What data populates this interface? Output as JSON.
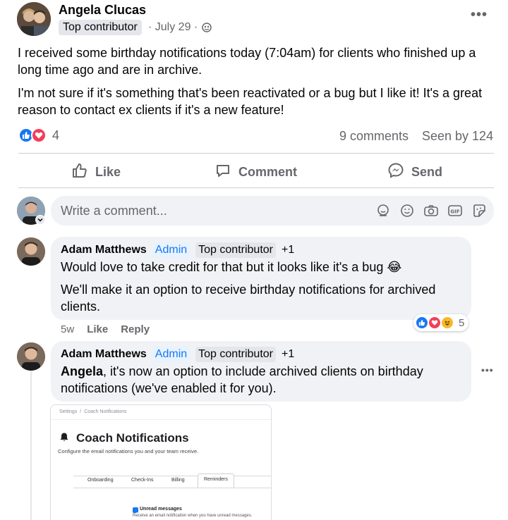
{
  "post": {
    "author": "Angela Clucas",
    "badge": "Top contributor",
    "date": "· July 29 ·",
    "paragraph1": "I received some birthday notifications today (7:04am)  for clients who finished up a long time ago and are in archive.",
    "paragraph2": "I'm not sure if it's something that's been reactivated or a bug but I like it! It's a great reason to contact ex clients if it's a new feature!",
    "reaction_count": "4",
    "comments": "9 comments",
    "seen": "Seen by 124"
  },
  "actions": {
    "like": "Like",
    "comment": "Comment",
    "send": "Send"
  },
  "composer": {
    "placeholder": "Write a comment..."
  },
  "comments": [
    {
      "author": "Adam Matthews",
      "admin": "Admin",
      "badge": "Top contributor",
      "plus": "+1",
      "line1": "Would love to take credit for that but it looks like it's a bug 😂",
      "line2": "We'll make it an option to receive birthday notifications for archived clients.",
      "time": "5w",
      "like": "Like",
      "reply": "Reply",
      "reaction_count": "5"
    },
    {
      "author": "Adam Matthews",
      "admin": "Admin",
      "badge": "Top contributor",
      "plus": "+1",
      "mention": "Angela",
      "text": ", it's now an option to include archived clients on birthday notifications (we've enabled it for you)."
    }
  ],
  "attachment": {
    "breadcrumb_settings": "Settings",
    "breadcrumb_sep": "/",
    "breadcrumb_page": "Coach Notifications",
    "title": "Coach Notifications",
    "subtitle": "Configure the email notifications you and your team receive.",
    "tabs": [
      "Onboarding",
      "Check-Ins",
      "Billing",
      "Reminders"
    ],
    "active_tab": "Reminders",
    "option_label": "Unread messages",
    "option_desc": "Receive an email notification when you have unread messages."
  },
  "colors": {
    "accent": "#1877f2",
    "like_blue": "#1877f2",
    "love_red": "#f33e58",
    "haha_yellow": "#f7b928"
  }
}
